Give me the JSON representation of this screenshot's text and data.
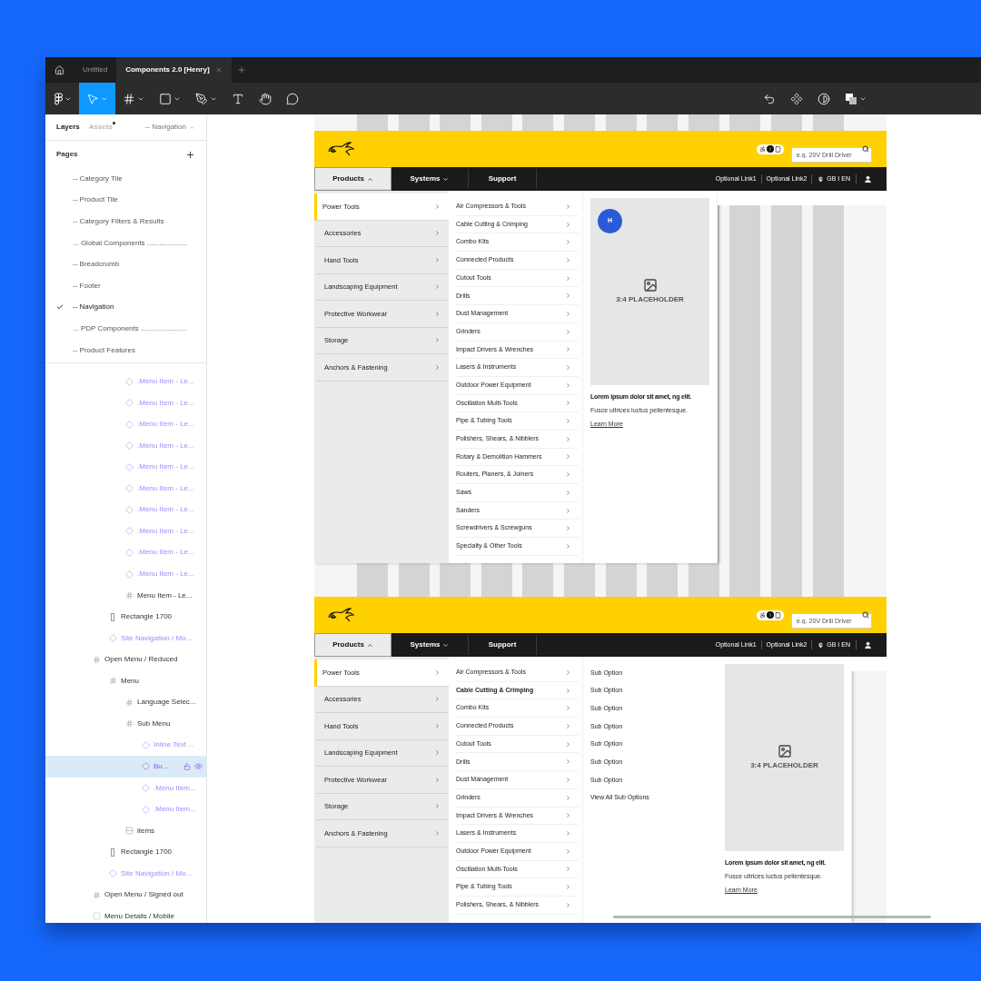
{
  "tabs": [
    {
      "label": "Untitled",
      "selected": false
    },
    {
      "label": "Components 2.0 [Henry]",
      "selected": true
    }
  ],
  "toolbar": {
    "tools": [
      {
        "kind": "main-menu",
        "selected": false,
        "caret": true
      },
      {
        "kind": "move",
        "selected": true,
        "caret": true
      },
      {
        "kind": "frame",
        "selected": false,
        "caret": true
      },
      {
        "kind": "shape",
        "selected": false,
        "caret": true
      },
      {
        "kind": "pen",
        "selected": false,
        "caret": true
      },
      {
        "kind": "text",
        "selected": false,
        "caret": false
      },
      {
        "kind": "hand",
        "selected": false,
        "caret": false
      },
      {
        "kind": "comment",
        "selected": false,
        "caret": false
      }
    ],
    "actions": [
      {
        "kind": "undo",
        "caret": false
      },
      {
        "kind": "component",
        "caret": false
      },
      {
        "kind": "contrast",
        "caret": false
      },
      {
        "kind": "boolean",
        "caret": true
      }
    ]
  },
  "panel": {
    "tabs": [
      {
        "label": "Layers",
        "selected": true,
        "unread": false
      },
      {
        "label": "Assets",
        "selected": false,
        "unread": true
      }
    ],
    "page_menu": "-- Navigation",
    "pages_title": "Pages",
    "pages": [
      {
        "label": "-- Category Tile",
        "selected": false
      },
      {
        "label": "-- Product Tile",
        "selected": false
      },
      {
        "label": "-- Category Filters & Results",
        "selected": false
      },
      {
        "label": "... Global Components ....................",
        "selected": false
      },
      {
        "label": "-- Breadcrumb",
        "selected": false
      },
      {
        "label": "-- Footer",
        "selected": false
      },
      {
        "label": "-- Navigation",
        "selected": true
      },
      {
        "label": "... PDP Components .......................",
        "selected": false
      },
      {
        "label": "-- Product Features",
        "selected": false
      }
    ],
    "layers": [
      {
        "children": [
          {
            "children": [
              {
                "name": ".Menu Item - Le...",
                "kind": "instance",
                "selected": false
              },
              {
                "name": ".Menu Item - Le...",
                "kind": "instance",
                "selected": false
              },
              {
                "name": ".Menu Item - Le...",
                "kind": "instance",
                "selected": false
              },
              {
                "name": ".Menu Item - Le...",
                "kind": "instance",
                "selected": false
              },
              {
                "name": ".Menu Item - Le...",
                "kind": "instance",
                "selected": false
              },
              {
                "name": ".Menu Item - Le...",
                "kind": "instance",
                "selected": false
              },
              {
                "name": ".Menu Item - Le...",
                "kind": "instance",
                "selected": false
              },
              {
                "name": ".Menu Item - Le...",
                "kind": "instance",
                "selected": false
              },
              {
                "name": ".Menu Item - Le...",
                "kind": "instance",
                "selected": false
              },
              {
                "name": ".Menu Item - Le...",
                "kind": "instance",
                "selected": false
              },
              {
                "name": "Menu Item - Le...",
                "kind": "frame",
                "selected": false
              }
            ]
          },
          {
            "name": "Rectangle 1700",
            "kind": "rectangle",
            "selected": false
          },
          {
            "name": "Site Navigation / Mo...",
            "kind": "instance",
            "selected": false
          }
        ]
      },
      {
        "name": "Open Menu / Reduced",
        "kind": "frame",
        "selected": false,
        "children": [
          {
            "name": "Menu",
            "kind": "frame",
            "selected": false,
            "children": [
              {
                "name": "Language Selec...",
                "kind": "frame",
                "selected": false
              },
              {
                "name": "Sub Menu",
                "kind": "frame",
                "selected": false,
                "children": [
                  {
                    "name": "Inline Text ...",
                    "kind": "instance",
                    "selected": false
                  },
                  {
                    "name": "Bu...",
                    "kind": "instance",
                    "selected": true
                  },
                  {
                    "name": ".Menu Item...",
                    "kind": "instance",
                    "selected": false
                  },
                  {
                    "name": ".Menu Item...",
                    "kind": "instance",
                    "selected": false
                  }
                ]
              },
              {
                "name": "items",
                "kind": "stack",
                "selected": false
              }
            ]
          },
          {
            "name": "Rectangle 1700",
            "kind": "rectangle",
            "selected": false
          },
          {
            "name": "Site Navigation / Mo...",
            "kind": "instance",
            "selected": false
          }
        ]
      },
      {
        "name": "Open Menu / Signed out",
        "kind": "frame",
        "selected": false
      },
      {
        "name": "Menu Details / Mobile",
        "kind": "section",
        "selected": false
      }
    ]
  },
  "designs": [
    {
      "search": {
        "placeholder": "e.g. 20V Drill Driver"
      },
      "nav": [
        {
          "label": "Products",
          "kind": "dropdown",
          "selected": true,
          "expanded": true
        },
        {
          "label": "Systems",
          "kind": "dropdown",
          "selected": false,
          "expanded": false
        },
        {
          "label": "Support",
          "kind": "link",
          "selected": false
        }
      ],
      "links": [
        "Optional Link1",
        "Optional Link2"
      ],
      "locale": "GB I EN",
      "categories": [
        {
          "label": "Power Tools",
          "selected": true
        },
        {
          "label": "Accessories",
          "selected": false
        },
        {
          "label": "Hand Tools",
          "selected": false
        },
        {
          "label": "Landscaping Equipment",
          "selected": false
        },
        {
          "label": "Protective Workwear",
          "selected": false
        },
        {
          "label": "Storage",
          "selected": false
        },
        {
          "label": "Anchors & Fastening",
          "selected": false
        }
      ],
      "subcategories": [
        {
          "label": "Air Compressors & Tools",
          "selected": false
        },
        {
          "label": "Cable Cutting & Crimping",
          "selected": false
        },
        {
          "label": "Combo Kits",
          "selected": false
        },
        {
          "label": "Connected Products",
          "selected": false
        },
        {
          "label": "Cutout Tools",
          "selected": false
        },
        {
          "label": "Drills",
          "selected": false
        },
        {
          "label": "Dust Management",
          "selected": false
        },
        {
          "label": "Grinders",
          "selected": false
        },
        {
          "label": "Impact Drivers & Wrenches",
          "selected": false
        },
        {
          "label": "Lasers & Instruments",
          "selected": false
        },
        {
          "label": "Outdoor Power Equipment",
          "selected": false
        },
        {
          "label": "Oscillation Multi-Tools",
          "selected": false
        },
        {
          "label": "Pipe & Tubing Tools",
          "selected": false
        },
        {
          "label": "Polishers, Shears, & Nibblers",
          "selected": false
        },
        {
          "label": "Rotary & Demolition Hammers",
          "selected": false
        },
        {
          "label": "Routers, Planers, & Joiners",
          "selected": false
        },
        {
          "label": "Saws",
          "selected": false
        },
        {
          "label": "Sanders",
          "selected": false
        },
        {
          "label": "Screwdrivers & Screwguns",
          "selected": false
        },
        {
          "label": "Specialty & Other Tools",
          "selected": false
        }
      ],
      "promo": {
        "badge": "H",
        "placeholder": "3:4 PLACEHOLDER",
        "title": "Lorem ipsum dolor sit amet, ng elit.",
        "body": "Fusce ultrices luctus pellentesque.",
        "link": "Learn More"
      }
    },
    {
      "search": {
        "placeholder": "e.g. 20V Drill Driver"
      },
      "nav": [
        {
          "label": "Products",
          "kind": "dropdown",
          "selected": true,
          "expanded": true
        },
        {
          "label": "Systems",
          "kind": "dropdown",
          "selected": false,
          "expanded": false
        },
        {
          "label": "Support",
          "kind": "link",
          "selected": false
        }
      ],
      "links": [
        "Optional Link1",
        "Optional Link2"
      ],
      "locale": "GB I EN",
      "categories": [
        {
          "label": "Power Tools",
          "selected": true
        },
        {
          "label": "Accessories",
          "selected": false
        },
        {
          "label": "Hand Tools",
          "selected": false
        },
        {
          "label": "Landscaping Equipment",
          "selected": false
        },
        {
          "label": "Protective Workwear",
          "selected": false
        },
        {
          "label": "Storage",
          "selected": false
        },
        {
          "label": "Anchors & Fastening",
          "selected": false
        }
      ],
      "subcategories": [
        {
          "label": "Air Compressors & Tools",
          "selected": false
        },
        {
          "label": "Cable Cutting & Crimping",
          "selected": true
        },
        {
          "label": "Combo Kits",
          "selected": false
        },
        {
          "label": "Connected Products",
          "selected": false
        },
        {
          "label": "Cutout Tools",
          "selected": false
        },
        {
          "label": "Drills",
          "selected": false
        },
        {
          "label": "Dust Management",
          "selected": false
        },
        {
          "label": "Grinders",
          "selected": false
        },
        {
          "label": "Impact Drivers & Wrenches",
          "selected": false
        },
        {
          "label": "Lasers & Instruments",
          "selected": false
        },
        {
          "label": "Outdoor Power Equipment",
          "selected": false
        },
        {
          "label": "Oscillation Multi-Tools",
          "selected": false
        },
        {
          "label": "Pipe & Tubing Tools",
          "selected": false
        },
        {
          "label": "Polishers, Shears, & Nibblers",
          "selected": false
        }
      ],
      "sub_options": [
        "Sub Option",
        "Sub Option",
        "Sub Option",
        "Sub Option",
        "Sub Option",
        "Sub Option",
        "Sub Option"
      ],
      "view_all": "View All Sub Options",
      "promo": {
        "placeholder": "3:4 PLACEHOLDER",
        "title": "Lorem ipsum dolor sit amet, ng elit.",
        "body": "Fusce ultrices luctus pellentesque.",
        "link": "Learn More"
      }
    }
  ]
}
